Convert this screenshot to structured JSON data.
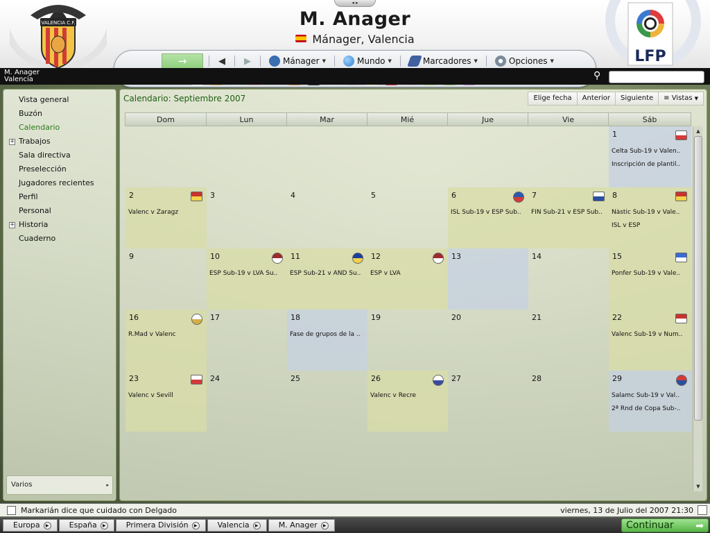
{
  "header": {
    "manager_name": "M. Anager",
    "manager_role": "Mánager, Valencia",
    "club_crest_text": "VALENCIA C.F.",
    "league_logo_text": "LFP",
    "handle": "◂ ▸"
  },
  "nav": {
    "forward_icon": "→",
    "back_arrow": "◀",
    "next_arrow": "▶",
    "menus": [
      {
        "label": "Mánager",
        "icon": "manager-icon",
        "color": "#3a6fb0"
      },
      {
        "label": "Mundo",
        "icon": "globe-icon",
        "color": "#3d8fd0"
      },
      {
        "label": "Marcadores",
        "icon": "scores-icon",
        "color": "#4060a0"
      },
      {
        "label": "Opciones",
        "icon": "options-icon",
        "color": "#7a8a9a"
      }
    ],
    "toolbar_icons": [
      {
        "name": "home-icon",
        "glyph": "⌂",
        "color": "#ffffff"
      },
      {
        "name": "meeting-icon",
        "glyph": "●",
        "color": "#e6c17a"
      },
      {
        "name": "news-icon",
        "glyph": "▤",
        "color": "#dde3ea"
      },
      {
        "name": "calendar-icon",
        "glyph": "▦",
        "color": "#f0c2c2"
      },
      {
        "name": "squad-icon",
        "glyph": "☻",
        "color": "#d8d8d8"
      },
      {
        "name": "transfers-icon",
        "glyph": "⇄",
        "color": "#e8a070"
      },
      {
        "name": "tactics-icon",
        "glyph": "▣",
        "color": "#3a3a3a"
      },
      {
        "name": "trophy-icon",
        "glyph": "♛",
        "color": "#e0e0e0"
      },
      {
        "name": "scouts-icon",
        "glyph": "☺",
        "color": "#d0d0d0"
      },
      {
        "name": "notes-icon",
        "glyph": "✎",
        "color": "#f5f0c8"
      },
      {
        "name": "match-icon",
        "glyph": "⚽",
        "color": "#e05050"
      },
      {
        "name": "binoculars-icon",
        "glyph": "∞",
        "color": "#d8d8d8"
      },
      {
        "name": "finances-icon",
        "glyph": "$",
        "color": "#b8e08a"
      },
      {
        "name": "help-icon",
        "glyph": "?",
        "color": "#9ad07a"
      },
      {
        "name": "faq-icon",
        "glyph": "?",
        "color": "#c79ae0"
      }
    ]
  },
  "context": {
    "line1": "M. Anager",
    "line2": "Valencia"
  },
  "sidebar": {
    "items": [
      {
        "label": "Vista general",
        "expandable": false,
        "active": false
      },
      {
        "label": "Buzón",
        "expandable": false,
        "active": false
      },
      {
        "label": "Calendario",
        "expandable": false,
        "active": true
      },
      {
        "label": "Trabajos",
        "expandable": true,
        "active": false
      },
      {
        "label": "Sala directiva",
        "expandable": false,
        "active": false
      },
      {
        "label": "Preselección",
        "expandable": false,
        "active": false
      },
      {
        "label": "Jugadores recientes",
        "expandable": false,
        "active": false
      },
      {
        "label": "Perfil",
        "expandable": false,
        "active": false
      },
      {
        "label": "Personal",
        "expandable": false,
        "active": false
      },
      {
        "label": "Historia",
        "expandable": true,
        "active": false
      },
      {
        "label": "Cuaderno",
        "expandable": false,
        "active": false
      }
    ],
    "varios_label": "Varios"
  },
  "calendar": {
    "title": "Calendario: Septiembre 2007",
    "buttons": {
      "pick_date": "Elige fecha",
      "previous": "Anterior",
      "next": "Siguiente",
      "views": "Vistas"
    },
    "day_headers": [
      "Dom",
      "Lun",
      "Mar",
      "Mié",
      "Jue",
      "Vie",
      "Sáb"
    ],
    "weeks": [
      [
        {
          "day": "",
          "events": [],
          "style": "none",
          "badge": null
        },
        {
          "day": "",
          "events": [],
          "style": "none",
          "badge": null
        },
        {
          "day": "",
          "events": [],
          "style": "none",
          "badge": null
        },
        {
          "day": "",
          "events": [],
          "style": "none",
          "badge": null
        },
        {
          "day": "",
          "events": [],
          "style": "none",
          "badge": null
        },
        {
          "day": "",
          "events": [],
          "style": "none",
          "badge": null
        },
        {
          "day": "1",
          "events": [
            "Celta Sub-19 v Valen..",
            "Inscripción de plantil.."
          ],
          "style": "blue",
          "badge": {
            "name": "celta-crest-icon",
            "colors": [
              "#ffffff",
              "#d53a3a"
            ],
            "round": false
          }
        }
      ],
      [
        {
          "day": "2",
          "events": [
            "Valenc v Zaragz"
          ],
          "style": "ev",
          "badge": {
            "name": "zaragoza-crest-icon",
            "colors": [
              "#c8342e",
              "#f1d34a"
            ],
            "round": false
          }
        },
        {
          "day": "3",
          "events": [],
          "style": "none",
          "badge": null
        },
        {
          "day": "4",
          "events": [],
          "style": "none",
          "badge": null
        },
        {
          "day": "5",
          "events": [],
          "style": "none",
          "badge": null
        },
        {
          "day": "6",
          "events": [
            "ISL Sub-19 v ESP Sub.."
          ],
          "style": "ev",
          "badge": {
            "name": "iceland-flag-icon",
            "colors": [
              "#2a5ab0",
              "#d23a3a"
            ],
            "round": true
          }
        },
        {
          "day": "7",
          "events": [
            "FIN Sub-21 v ESP Sub.."
          ],
          "style": "ev",
          "badge": {
            "name": "finland-flag-icon",
            "colors": [
              "#ffffff",
              "#2a4fa0"
            ],
            "round": false
          }
        },
        {
          "day": "8",
          "events": [
            "Nàstic Sub-19 v Vale..",
            "ISL v ESP"
          ],
          "style": "ev",
          "badge": {
            "name": "nastic-crest-icon",
            "colors": [
              "#c8342e",
              "#f1d34a"
            ],
            "round": false
          }
        }
      ],
      [
        {
          "day": "9",
          "events": [],
          "style": "none",
          "badge": null
        },
        {
          "day": "10",
          "events": [
            "ESP Sub-19 v LVA Su.."
          ],
          "style": "ev",
          "badge": {
            "name": "latvia-flag-icon",
            "colors": [
              "#9e2a2a",
              "#ffffff"
            ],
            "round": true
          }
        },
        {
          "day": "11",
          "events": [
            "ESP Sub-21 v AND Su.."
          ],
          "style": "ev",
          "badge": {
            "name": "andorra-flag-icon",
            "colors": [
              "#1a3ea0",
              "#f1d34a"
            ],
            "round": true
          }
        },
        {
          "day": "12",
          "events": [
            "ESP v LVA"
          ],
          "style": "ev",
          "badge": {
            "name": "latvia-flag-icon",
            "colors": [
              "#9e2a2a",
              "#ffffff"
            ],
            "round": true
          }
        },
        {
          "day": "13",
          "events": [],
          "style": "blue",
          "badge": null
        },
        {
          "day": "14",
          "events": [],
          "style": "none",
          "badge": null
        },
        {
          "day": "15",
          "events": [
            "Ponfer Sub-19 v Vale.."
          ],
          "style": "ev",
          "badge": {
            "name": "ponferradina-crest-icon",
            "colors": [
              "#3b6bd0",
              "#ffffff"
            ],
            "round": false
          }
        }
      ],
      [
        {
          "day": "16",
          "events": [
            "R.Mad v Valenc"
          ],
          "style": "ev",
          "badge": {
            "name": "real-madrid-crest-icon",
            "colors": [
              "#ffffff",
              "#d4b044"
            ],
            "round": true
          }
        },
        {
          "day": "17",
          "events": [],
          "style": "none",
          "badge": null
        },
        {
          "day": "18",
          "events": [
            "Fase de grupos de la .."
          ],
          "style": "blue",
          "badge": null
        },
        {
          "day": "19",
          "events": [],
          "style": "none",
          "badge": null
        },
        {
          "day": "20",
          "events": [],
          "style": "none",
          "badge": null
        },
        {
          "day": "21",
          "events": [],
          "style": "none",
          "badge": null
        },
        {
          "day": "22",
          "events": [
            "Valenc Sub-19 v Num.."
          ],
          "style": "ev",
          "badge": {
            "name": "numancia-crest-icon",
            "colors": [
              "#c8342e",
              "#ffffff"
            ],
            "round": false
          }
        }
      ],
      [
        {
          "day": "23",
          "events": [
            "Valenc v Sevill"
          ],
          "style": "ev",
          "badge": {
            "name": "sevilla-crest-icon",
            "colors": [
              "#ffffff",
              "#d23a3a"
            ],
            "round": false
          }
        },
        {
          "day": "24",
          "events": [],
          "style": "none",
          "badge": null
        },
        {
          "day": "25",
          "events": [],
          "style": "none",
          "badge": null
        },
        {
          "day": "26",
          "events": [
            "Valenc v Recre"
          ],
          "style": "ev",
          "badge": {
            "name": "recreativo-crest-icon",
            "colors": [
              "#ffffff",
              "#3a4aa0"
            ],
            "round": true
          }
        },
        {
          "day": "27",
          "events": [],
          "style": "none",
          "badge": null
        },
        {
          "day": "28",
          "events": [],
          "style": "none",
          "badge": null
        },
        {
          "day": "29",
          "events": [
            "Salamc Sub-19 v Val..",
            "2ª Rnd de Copa Sub-.."
          ],
          "style": "blue",
          "badge": {
            "name": "salamanca-crest-icon",
            "colors": [
              "#d23a3a",
              "#2a4fa0"
            ],
            "round": true
          }
        }
      ]
    ]
  },
  "status": {
    "message": "Markarián dice que cuidado con Delgado",
    "datetime": "viernes, 13 de Julio del 2007 21:30"
  },
  "breadcrumbs": [
    "Europa",
    "España",
    "Primera División",
    "Valencia",
    "M. Anager"
  ],
  "continue_label": "Continuar",
  "colors": {
    "accent_green": "#2b7a1a",
    "continue_green": "#57b547"
  }
}
